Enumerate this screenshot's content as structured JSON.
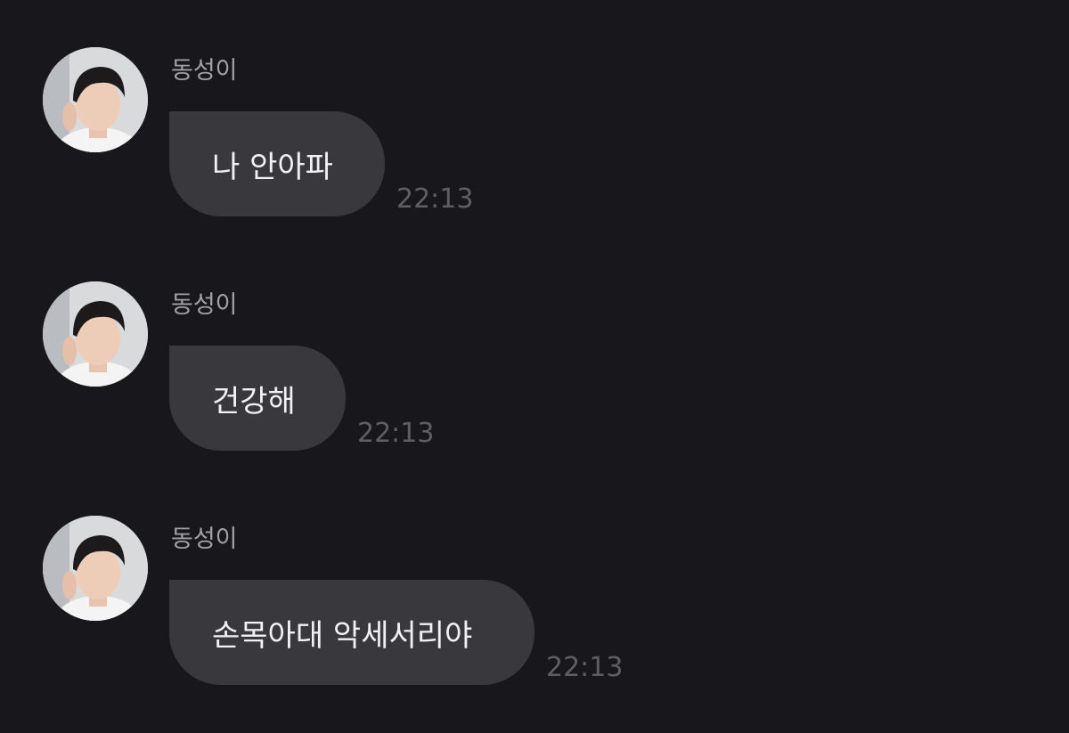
{
  "messages": [
    {
      "sender": "동성이",
      "text": "나 안아파",
      "time": "22:13",
      "avatar_icon": "profile-photo"
    },
    {
      "sender": "동성이",
      "text": "건강해",
      "time": "22:13",
      "avatar_icon": "profile-photo"
    },
    {
      "sender": "동성이",
      "text": "손목아대 악세서리야",
      "time": "22:13",
      "avatar_icon": "profile-photo"
    }
  ],
  "colors": {
    "background": "#18181c",
    "bubble": "#38383d",
    "message_text": "#f1f1f3",
    "sender_text": "#a1a1a7",
    "time_text": "#5e5e63"
  }
}
